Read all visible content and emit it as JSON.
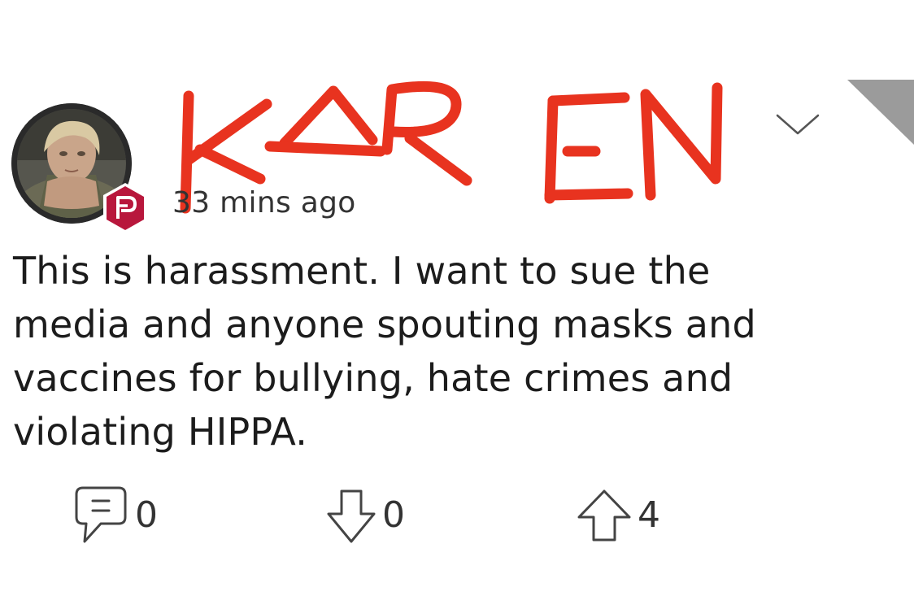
{
  "post": {
    "name_scribble_text": "KAR EN",
    "timestamp": "33 mins ago",
    "body": "This is harassment. I want to sue the\nmedia and anyone spouting masks and\nvaccines for bullying, hate crimes and\nviolating HIPPA.",
    "actions": {
      "comments_count": "0",
      "downvotes_count": "0",
      "upvotes_count": "4"
    }
  },
  "icons": {
    "avatar": "avatar-photo",
    "badge": "parler-p-icon",
    "menu": "chevron-down-icon",
    "comment": "comment-bubble-icon",
    "downvote": "arrow-down-outline-icon",
    "upvote": "arrow-up-outline-icon"
  },
  "colors": {
    "scribble": "#e8331f",
    "badge": "#b8173c",
    "corner": "#9b9b9b",
    "icon_stroke": "#444444"
  }
}
